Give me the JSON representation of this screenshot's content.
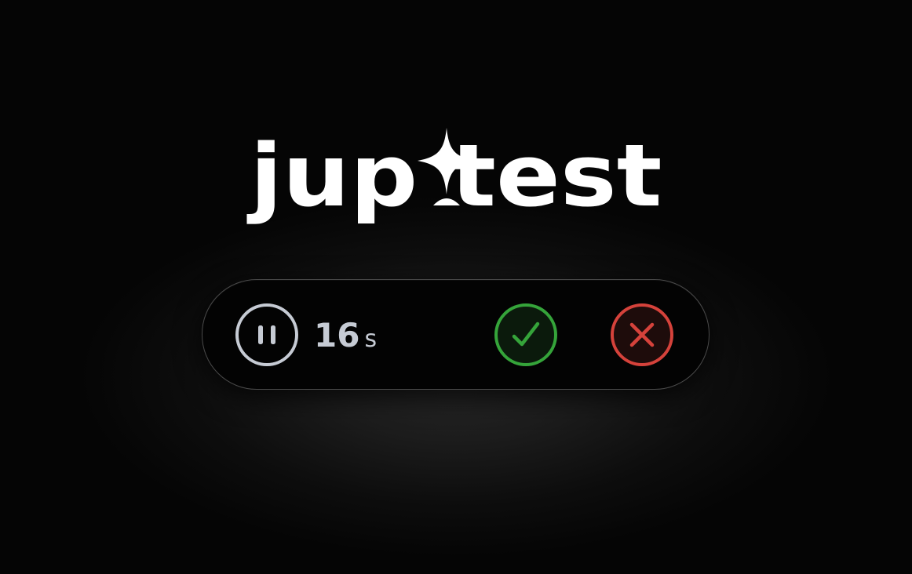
{
  "brand": {
    "logo_text": "jup test",
    "logo_color": "#ffffff"
  },
  "control_bar": {
    "pause": {
      "icon": "pause-icon",
      "color": "#c6cbd4"
    },
    "timer": {
      "value": "16",
      "unit": "s"
    },
    "approve": {
      "icon": "checkmark-icon",
      "color": "#35a43a"
    },
    "reject": {
      "icon": "close-icon",
      "color": "#d5423b"
    }
  }
}
